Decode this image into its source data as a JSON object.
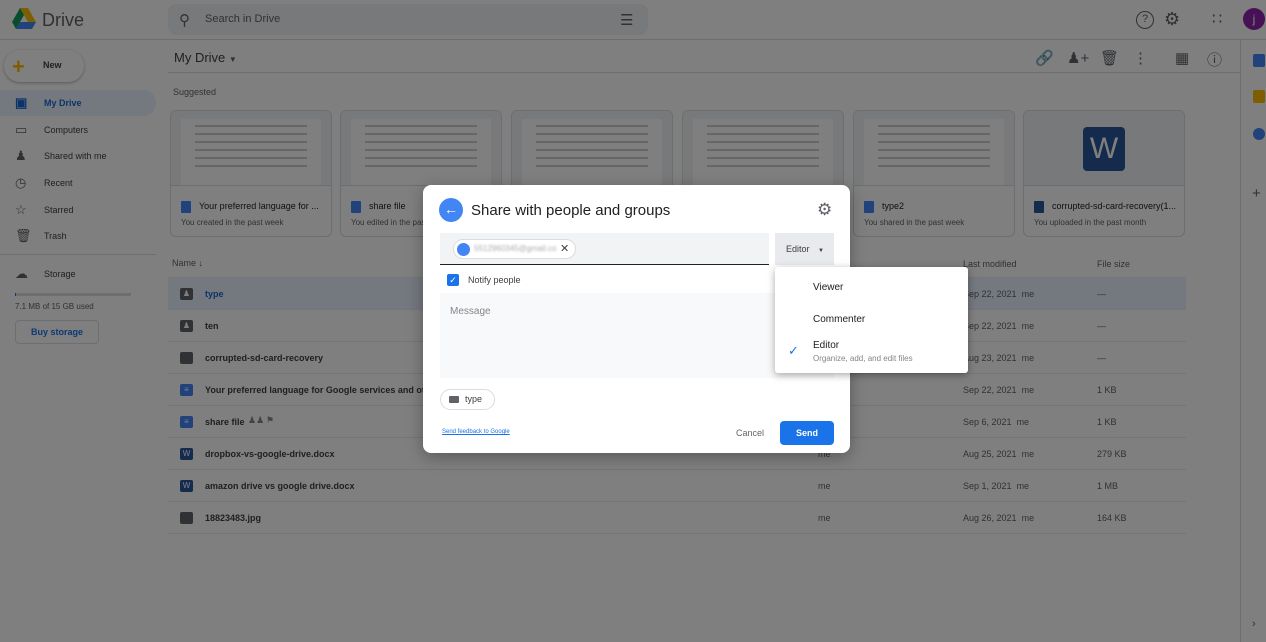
{
  "app": {
    "title": "Drive",
    "search_placeholder": "Search in Drive",
    "avatar_letter": "j"
  },
  "sidebar": {
    "new_label": "New",
    "items": [
      {
        "label": "My Drive"
      },
      {
        "label": "Computers"
      },
      {
        "label": "Shared with me"
      },
      {
        "label": "Recent"
      },
      {
        "label": "Starred"
      },
      {
        "label": "Trash"
      }
    ],
    "storage_label": "Storage",
    "storage_used": "7.1 MB of 15 GB used",
    "storage_fraction": 0.0005,
    "buy_storage": "Buy storage"
  },
  "main": {
    "title": "My Drive",
    "suggested_label": "Suggested",
    "cards": [
      {
        "title": "Your preferred language for ...",
        "sub": "You created in the past week",
        "type": "doc"
      },
      {
        "title": "share file",
        "sub": "You edited in the past week",
        "type": "doc"
      },
      {
        "title": "",
        "sub": "",
        "type": "image"
      },
      {
        "title": "",
        "sub": "",
        "type": "doc"
      },
      {
        "title": "type2",
        "sub": "You shared in the past week",
        "type": "doc"
      },
      {
        "title": "corrupted-sd-card-recovery(1...",
        "sub": "You uploaded in the past month",
        "type": "word"
      }
    ],
    "columns": {
      "name": "Name",
      "last_modified": "Last modified",
      "file_size": "File size"
    },
    "rows": [
      {
        "name": "type",
        "type": "shared-folder",
        "owner": "",
        "modified": "Sep 22, 2021",
        "by": "me",
        "size": "—"
      },
      {
        "name": "ten",
        "type": "shared-folder",
        "owner": "",
        "modified": "Sep 22, 2021",
        "by": "me",
        "size": "—"
      },
      {
        "name": "corrupted-sd-card-recovery",
        "type": "folder",
        "owner": "",
        "modified": "Aug 23, 2021",
        "by": "me",
        "size": "—"
      },
      {
        "name": "Your preferred language for Google services and other la",
        "type": "doc",
        "owner": "",
        "modified": "Sep 22, 2021",
        "by": "me",
        "size": "1 KB"
      },
      {
        "name": "share file",
        "type": "doc",
        "owner": "",
        "modified": "Sep 6, 2021",
        "by": "me",
        "size": "1 KB"
      },
      {
        "name": "dropbox-vs-google-drive.docx",
        "type": "word",
        "owner": "me",
        "modified": "Aug 25, 2021",
        "by": "me",
        "size": "279 KB"
      },
      {
        "name": "amazon drive vs google drive.docx",
        "type": "word",
        "owner": "me",
        "modified": "Sep 1, 2021",
        "by": "me",
        "size": "1 MB"
      },
      {
        "name": "18823483.jpg",
        "type": "image",
        "owner": "me",
        "modified": "Aug 26, 2021",
        "by": "me",
        "size": "164 KB"
      }
    ]
  },
  "dialog": {
    "title": "Share with people and groups",
    "chip_text": "5512960345@gmail.com",
    "role": "Editor",
    "notify_label": "Notify people",
    "notify_checked": true,
    "message_placeholder": "Message",
    "item_chip": "type",
    "feedback_link": "Send feedback to Google",
    "cancel": "Cancel",
    "send": "Send",
    "menu": [
      {
        "label": "Viewer"
      },
      {
        "label": "Commenter"
      },
      {
        "label": "Editor",
        "desc": "Organize, add, and edit files",
        "selected": true
      }
    ]
  },
  "colors": {
    "accent": "#1a73e8",
    "selected_bg": "#e8f0fe",
    "avatar": "#8e24aa"
  }
}
